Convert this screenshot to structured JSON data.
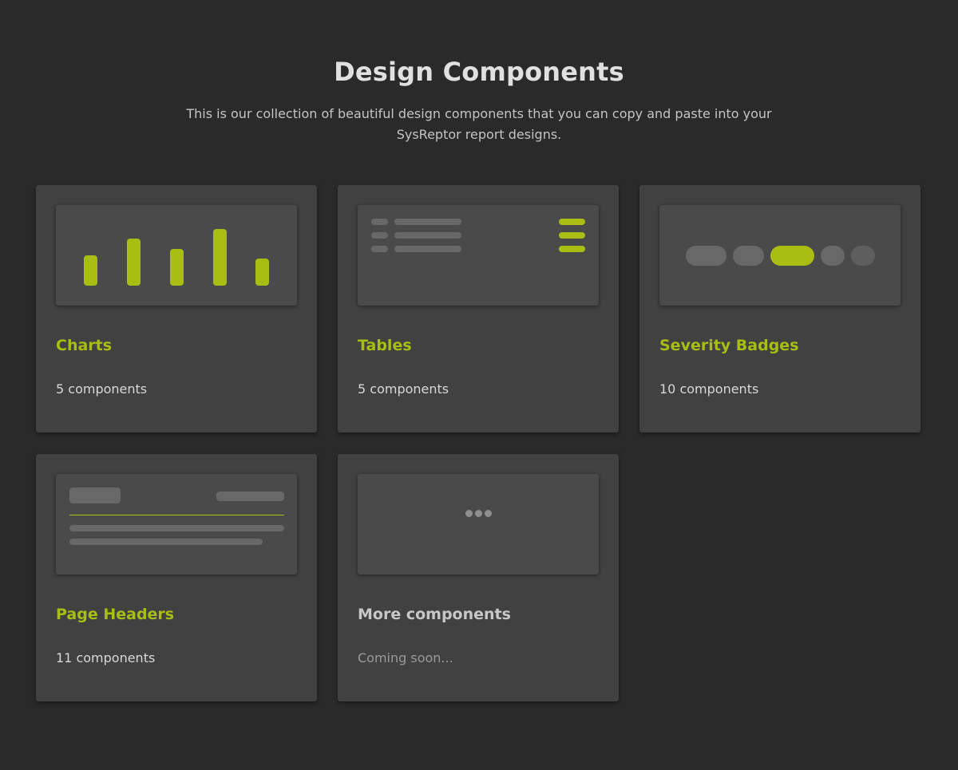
{
  "header": {
    "title": "Design Components",
    "subtitle": "This is our collection of beautiful design components that you can copy and paste into your SysReptor report designs."
  },
  "cards": [
    {
      "title": "Charts",
      "count": "5 components"
    },
    {
      "title": "Tables",
      "count": "5 components"
    },
    {
      "title": "Severity Badges",
      "count": "10 components"
    },
    {
      "title": "Page Headers",
      "count": "11 components"
    },
    {
      "title": "More components",
      "count": "Coming soon..."
    }
  ],
  "colors": {
    "background": "#2a2a2a",
    "card": "#414141",
    "accent": "#a9be12",
    "placeholder": "#5e5e5e"
  }
}
